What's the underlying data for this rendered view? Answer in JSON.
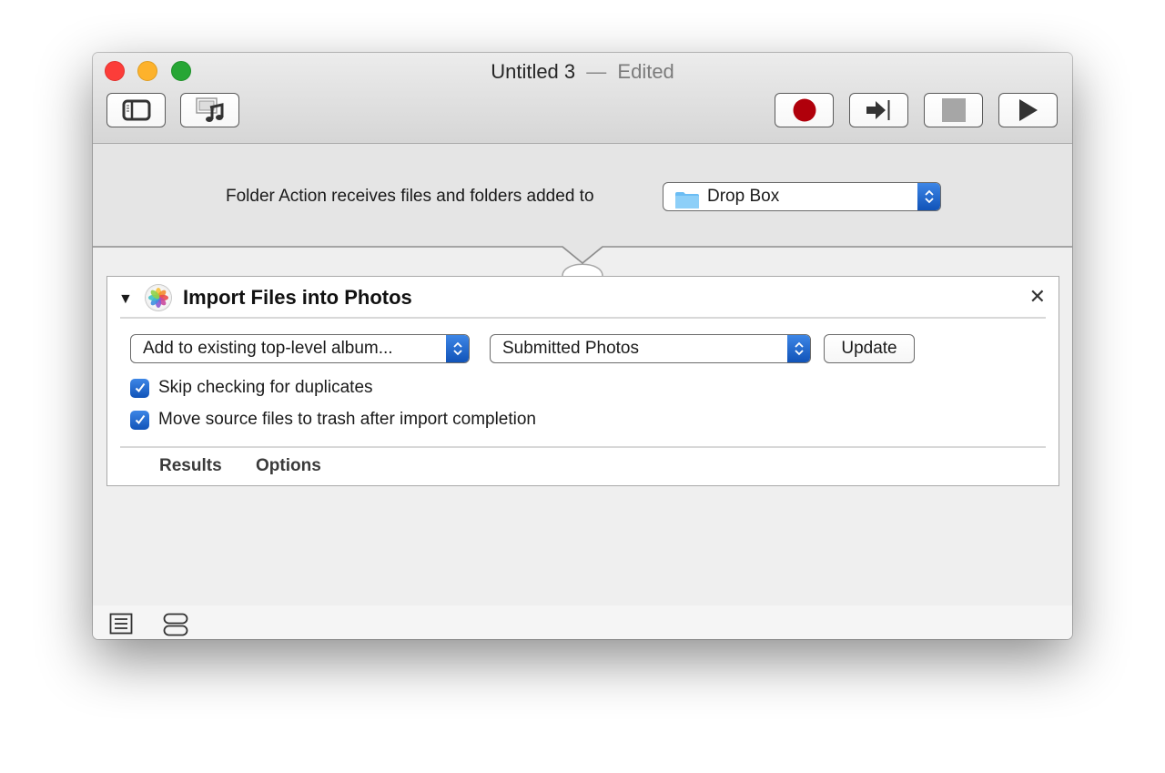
{
  "window": {
    "title": "Untitled 3",
    "title_separator": "—",
    "status": "Edited",
    "traffic_lights": [
      {
        "name": "close",
        "color": "#fc3d39"
      },
      {
        "name": "minimize",
        "color": "#fdb22c"
      },
      {
        "name": "zoom",
        "color": "#27a635"
      }
    ]
  },
  "toolbar": {
    "left_buttons": [
      {
        "icon": "sidebar-icon",
        "label": "Library"
      },
      {
        "icon": "media-icon",
        "label": "Media"
      }
    ],
    "right_buttons": [
      {
        "icon": "record-icon",
        "label": "Record",
        "color": "#b0000b"
      },
      {
        "icon": "step-icon",
        "label": "Step"
      },
      {
        "icon": "stop-icon",
        "label": "Stop",
        "color": "#a6a6a6"
      },
      {
        "icon": "run-icon",
        "label": "Run"
      }
    ]
  },
  "workflow_header": {
    "label": "Folder Action receives files and folders added to",
    "folder_popup": {
      "value": "Drop Box",
      "icon": "folder-icon"
    }
  },
  "action": {
    "title": "Import Files into Photos",
    "icon": "photos-icon",
    "close_glyph": "✕",
    "disclosure_glyph": "▼",
    "mode_popup": {
      "value": "Add to existing top-level album..."
    },
    "album_popup": {
      "value": "Submitted Photos"
    },
    "update_button": "Update",
    "checkboxes": [
      {
        "label": "Skip checking for duplicates",
        "checked": true
      },
      {
        "label": "Move source files to trash after import completion",
        "checked": true
      }
    ],
    "footer_tabs": [
      {
        "label": "Results"
      },
      {
        "label": "Options"
      }
    ]
  },
  "bottombar": {
    "buttons": [
      {
        "icon": "log-icon",
        "label": "Show log"
      },
      {
        "icon": "variables-icon",
        "label": "Show variables"
      }
    ]
  },
  "colors": {
    "accent": "#1a62c9",
    "record": "#b0000b"
  }
}
